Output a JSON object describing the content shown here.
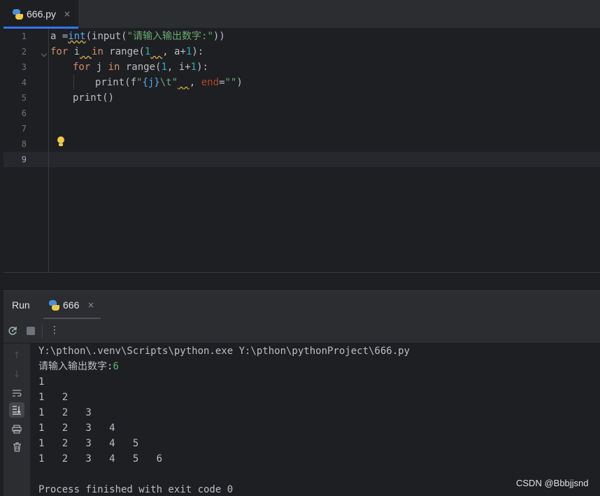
{
  "editor": {
    "tab": {
      "filename": "666.py",
      "close": "×",
      "icon": "python-file-icon"
    },
    "line_numbers": [
      "1",
      "2",
      "3",
      "4",
      "5",
      "6",
      "7",
      "8",
      "9"
    ],
    "current_line": 9,
    "code": {
      "l1": {
        "a": "a =",
        "b": "int",
        "c": "(input(",
        "d": "\"请输入输出数字:\"",
        "e": "))"
      },
      "l2": {
        "a": "for",
        "b": " i",
        "c": "  ",
        "d": "in",
        "e": " range(",
        "f": "1",
        "g": "  ",
        "h": ", a+",
        "i": "1",
        "j": "):"
      },
      "l3": {
        "a": "for",
        "b": " j ",
        "c": "in",
        "d": " range(",
        "e": "1",
        "f": ", i+",
        "g": "1",
        "h": "):"
      },
      "l4": {
        "a": "print(f",
        "b": "\"",
        "c": "{j}",
        "d": "\\t\"",
        "e": "  ",
        "f": ", ",
        "g": "end",
        "h": "=",
        "i": "\"\"",
        "j": ")"
      },
      "l5": {
        "a": "print()"
      }
    },
    "intention_icon": "lightbulb-icon"
  },
  "run_panel": {
    "title": "Run",
    "tab": {
      "label": "666",
      "close": "×",
      "icon": "python-file-icon"
    },
    "toolbar": {
      "rerun_icon": "rerun-icon",
      "stop_icon": "stop-icon",
      "more_label": "⋮"
    },
    "side_icons": [
      "arrow-up-icon",
      "arrow-down-icon",
      "soft-wrap-icon",
      "scroll-to-end-icon",
      "print-icon",
      "trash-icon"
    ],
    "console": {
      "command": "Y:\\pthon\\.venv\\Scripts\\python.exe Y:\\pthon\\pythonProject\\666.py",
      "prompt": "请输入输出数字:",
      "input_value": "6",
      "rows": [
        "1",
        "1   2",
        "1   2   3",
        "1   2   3   4",
        "1   2   3   4   5",
        "1   2   3   4   5   6"
      ],
      "exit_message": "Process finished with exit code 0"
    }
  },
  "watermark": "CSDN @Bbbjjsnd",
  "colors": {
    "accent": "#3574f0",
    "keyword": "#cf8e6d",
    "function": "#56a8f5",
    "string": "#6aab73",
    "number": "#2aacb8",
    "param": "#aa4926",
    "console_input": "#5fb865"
  }
}
